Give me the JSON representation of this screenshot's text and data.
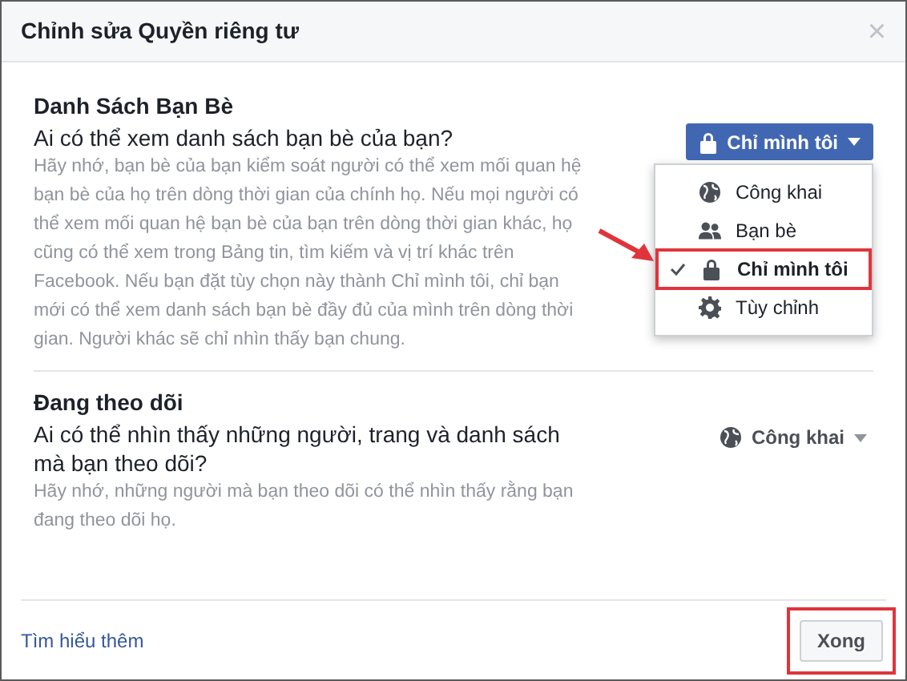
{
  "dialog": {
    "title": "Chỉnh sửa Quyền riêng tư",
    "close": "×"
  },
  "sections": [
    {
      "heading": "Danh Sách Bạn Bè",
      "question": "Ai có thể xem danh sách bạn bè của bạn?",
      "description": "Hãy nhớ, bạn bè của bạn kiểm soát người có thể xem mối quan hệ bạn bè của họ trên dòng thời gian của chính họ. Nếu mọi người có thể xem mối quan hệ bạn bè của bạn trên dòng thời gian khác, họ cũng có thể xem trong Bảng tin, tìm kiếm và vị trí khác trên Facebook. Nếu bạn đặt tùy chọn này thành Chỉ mình tôi, chỉ bạn mới có thể xem danh sách bạn bè đầy đủ của mình trên dòng thời gian. Người khác sẽ chỉ nhìn thấy bạn chung.",
      "audience": {
        "label": "Chỉ mình tôi",
        "kind": "lock",
        "open": true
      },
      "menu": [
        {
          "label": "Công khai",
          "kind": "globe",
          "selected": false,
          "annotated": false
        },
        {
          "label": "Bạn bè",
          "kind": "friends",
          "selected": false,
          "annotated": false
        },
        {
          "label": "Chỉ mình tôi",
          "kind": "lock",
          "selected": true,
          "annotated": true
        },
        {
          "label": "Tùy chỉnh",
          "kind": "gear",
          "selected": false,
          "annotated": false
        }
      ]
    },
    {
      "heading": "Đang theo dõi",
      "question": "Ai có thể nhìn thấy những người, trang và danh sách mà bạn theo dõi?",
      "description": "Hãy nhớ, những người mà bạn theo dõi có thể nhìn thấy rằng bạn đang theo dõi họ.",
      "audience": {
        "label": "Công khai",
        "kind": "globe",
        "open": false
      }
    }
  ],
  "footer": {
    "link": "Tìm hiểu thêm",
    "done": {
      "label": "Xong",
      "annotated": true
    }
  }
}
